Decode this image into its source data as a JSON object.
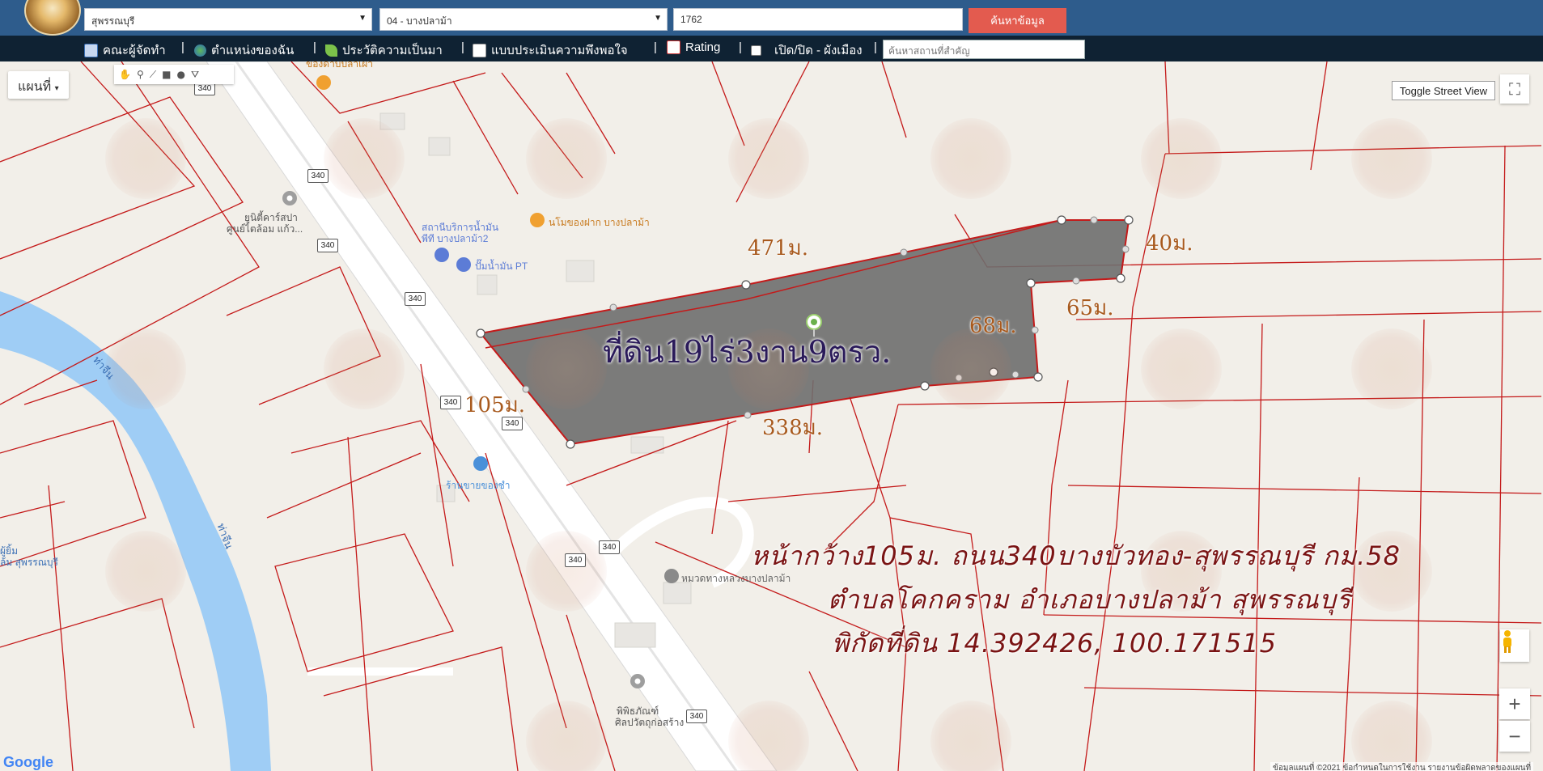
{
  "header": {
    "province_select": "สุพรรณบุรี",
    "district_select": "04 - บางปลาม้า",
    "parcel_number": "1762",
    "search_button": "ค้นหาข้อมูล"
  },
  "navbar": {
    "items": [
      {
        "label": "คณะผู้จัดทำ",
        "icon": "team-icon"
      },
      {
        "label": "ตำแหน่งของฉัน",
        "icon": "globe-icon"
      },
      {
        "label": "ประวัติความเป็นมา",
        "icon": "sprout-icon"
      },
      {
        "label": "แบบประเมินความพึงพอใจ",
        "icon": "form-icon"
      },
      {
        "label": "Rating",
        "icon": "chart-icon"
      },
      {
        "label": "เปิด/ปิด - ผังเมือง",
        "icon": "checkbox-icon"
      }
    ],
    "separator": "|",
    "place_search_placeholder": "ค้นหาสถานที่สำคัญ"
  },
  "map": {
    "map_type": "แผนที่",
    "toggle_street_view": "Toggle Street View",
    "google_logo": "Google",
    "attribution": "ข้อมูลแผนที่ ©2021   ข้อกำหนดในการใช้งาน   รายงานข้อผิดพลาดของแผนที่",
    "zoom_in": "+",
    "zoom_out": "−",
    "road_shield": "340",
    "river_label": "ท่าจีน",
    "poi": {
      "restaurant_top": "ของดาบปลาเผา",
      "car_service": "ยูนิตี้คาร์สปา",
      "car_service_2": "ศูนย์ไตล้อม แก้ว...",
      "gas_station": "สถานีบริการน้ำมัน",
      "gas_station_2": "พีที บางปลาม้า2",
      "gas_pump": "ปั๊มน้ำมัน PT",
      "restaurant": "นโมของฝาก บางปลาม้า",
      "shop": "ร้านขายของชำ",
      "highway_office": "หมวดทางหลวงบางปลาม้า",
      "museum": "พิพิธภัณฑ์",
      "museum_2": "ศิลปวัตถุก่อสร้าง",
      "left_place": "ผู้ยิ้ม",
      "left_place_2": "ล้ม สุพรรณบุรี"
    }
  },
  "parcel": {
    "area_label": "ที่ดิน19ไร่3งาน9ตรว.",
    "dimensions": {
      "north": "471ม.",
      "northeast": "40ม.",
      "east_inner": "68ม.",
      "east_step": "65ม.",
      "south": "338ม.",
      "front": "105ม."
    },
    "fill_color": "#6e6e6e",
    "boundary_color": "#c41a1a"
  },
  "description": {
    "line1": "หน้ากว้าง105ม. ถนน340บางบัวทอง-สุพรรณบุรี กม.58",
    "line2": "ตำบลโคกคราม อำเภอบางปลาม้า สุพรรณบุรี",
    "line3": "พิกัดที่ดิน 14.392426, 100.171515"
  }
}
